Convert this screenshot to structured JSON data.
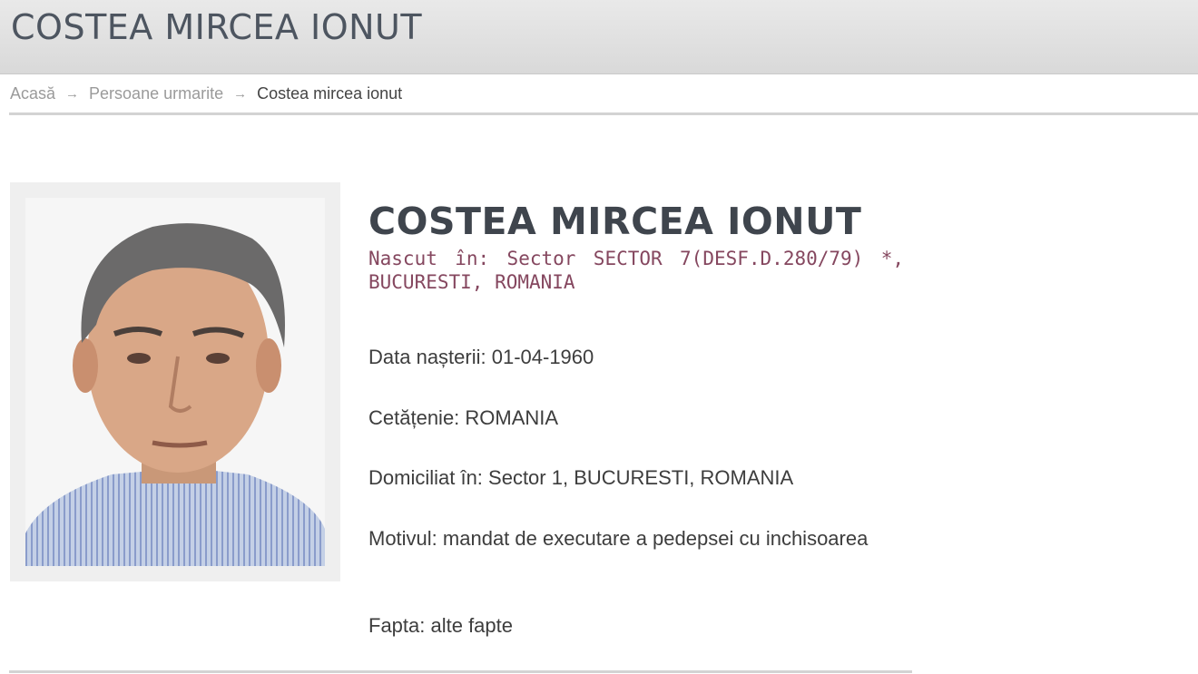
{
  "header": {
    "title": "COSTEA MIRCEA IONUT"
  },
  "breadcrumb": {
    "items": [
      {
        "label": "Acasă"
      },
      {
        "label": "Persoane urmarite"
      }
    ],
    "separator": "→",
    "current": "Costea mircea ionut"
  },
  "person": {
    "photo_icon": "person-photo",
    "name": "COSTEA MIRCEA IONUT",
    "birthplace": "Nascut în: Sector SECTOR 7(DESF.D.280/79) *, BUCURESTI, ROMANIA",
    "birthdate": "Data nașterii: 01-04-1960",
    "citizenship": "Cetățenie: ROMANIA",
    "domicile": "Domiciliat în: Sector 1, BUCURESTI, ROMANIA",
    "reason": "Motivul: mandat de executare a pedepsei cu inchisoarea",
    "offense": "Fapta: alte fapte"
  },
  "colors": {
    "title": "#4d5560",
    "heading": "#3f454d",
    "birthplace": "#85475f",
    "body_text": "#3d3d3d",
    "link_muted": "#9a9a9a"
  }
}
